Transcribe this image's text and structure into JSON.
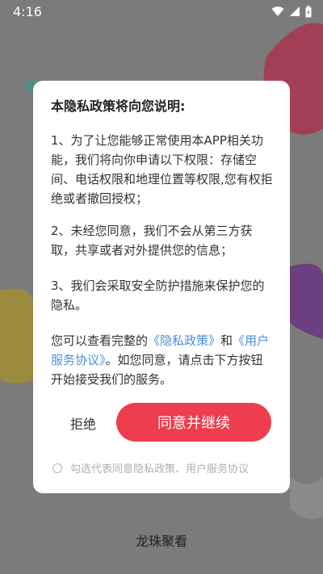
{
  "status_bar": {
    "time": "4:16",
    "icons": [
      "wifi-icon",
      "signal-icon",
      "battery-charging-icon"
    ]
  },
  "dialog": {
    "title": "本隐私政策将向您说明:",
    "para1": "1、为了让您能够正常使用本APP相关功能，我们将向你申请以下权限：存储空间、电话权限和地理位置等权限,您有权拒绝或者撤回授权；",
    "para2": "2、未经您同意，我们不会从第三方获取，共享或者对外提供您的信息；",
    "para3": "3、我们会采取安全防护措施来保护您的隐私。",
    "para4_prefix": "您可以查看完整的",
    "privacy_link": "《隐私政策》",
    "para4_and": "和",
    "terms_link": "《用户服务协议》",
    "para4_suffix": "。如您同意，请点击下方按钮开始接受我们的服务。",
    "reject_label": "拒绝",
    "agree_label": "同意并继续",
    "consent_text": "勾选代表同意隐私政策、用户服务协议"
  },
  "app_name": "龙珠聚看",
  "colors": {
    "accent": "#ee3d4d",
    "link": "#4a90d9",
    "overlay": "#7b7b7b"
  }
}
